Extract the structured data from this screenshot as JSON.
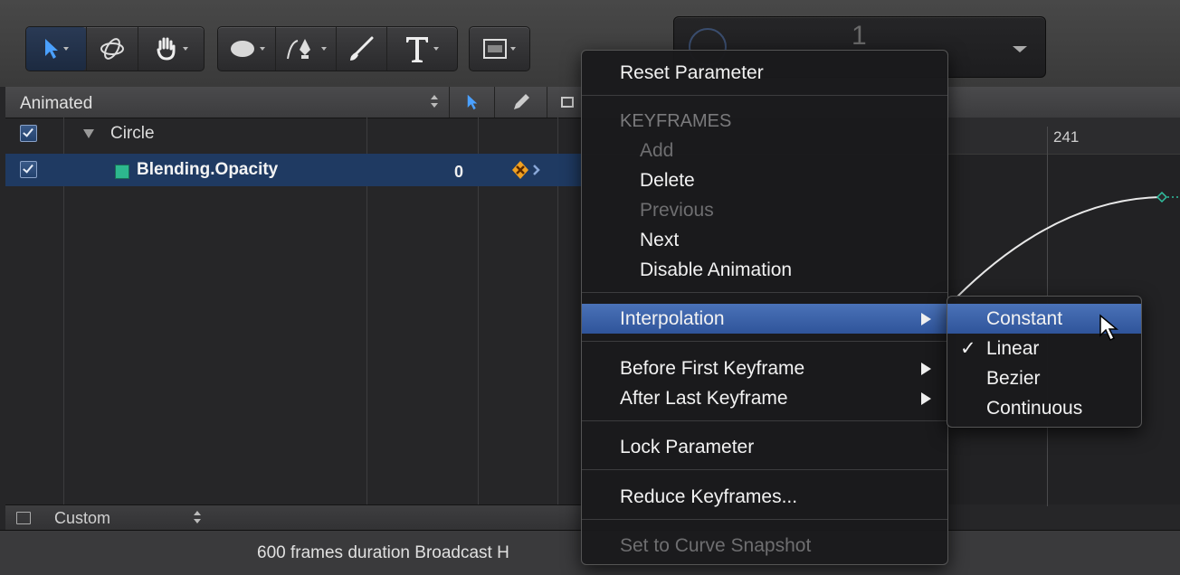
{
  "toolbar": {
    "timecode_value": "1"
  },
  "layers_panel": {
    "filter_label": "Animated",
    "rows": [
      {
        "label": "Circle",
        "checked": true
      },
      {
        "label": "Blending.Opacity",
        "checked": true,
        "value": "0",
        "swatch_color": "#2db88e"
      }
    ],
    "footer_label": "Custom"
  },
  "timeline": {
    "ruler_label": "241"
  },
  "status": {
    "text": "600 frames duration Broadcast H"
  },
  "context_menu": {
    "reset_parameter": "Reset Parameter",
    "keyframes_header": "KEYFRAMES",
    "add": "Add",
    "delete": "Delete",
    "previous": "Previous",
    "next": "Next",
    "disable_animation": "Disable Animation",
    "interpolation": "Interpolation",
    "before_first_keyframe": "Before First Keyframe",
    "after_last_keyframe": "After Last Keyframe",
    "lock_parameter": "Lock Parameter",
    "reduce_keyframes": "Reduce Keyframes...",
    "set_to_curve_snapshot": "Set to Curve Snapshot"
  },
  "interpolation_submenu": {
    "constant": "Constant",
    "linear": "Linear",
    "bezier": "Bezier",
    "continuous": "Continuous",
    "selected": "Linear",
    "checkmark": "✓"
  },
  "colors": {
    "highlight": "#3e64aa",
    "selected_row": "#1f3a62",
    "keyframe_orange": "#f0a020"
  }
}
